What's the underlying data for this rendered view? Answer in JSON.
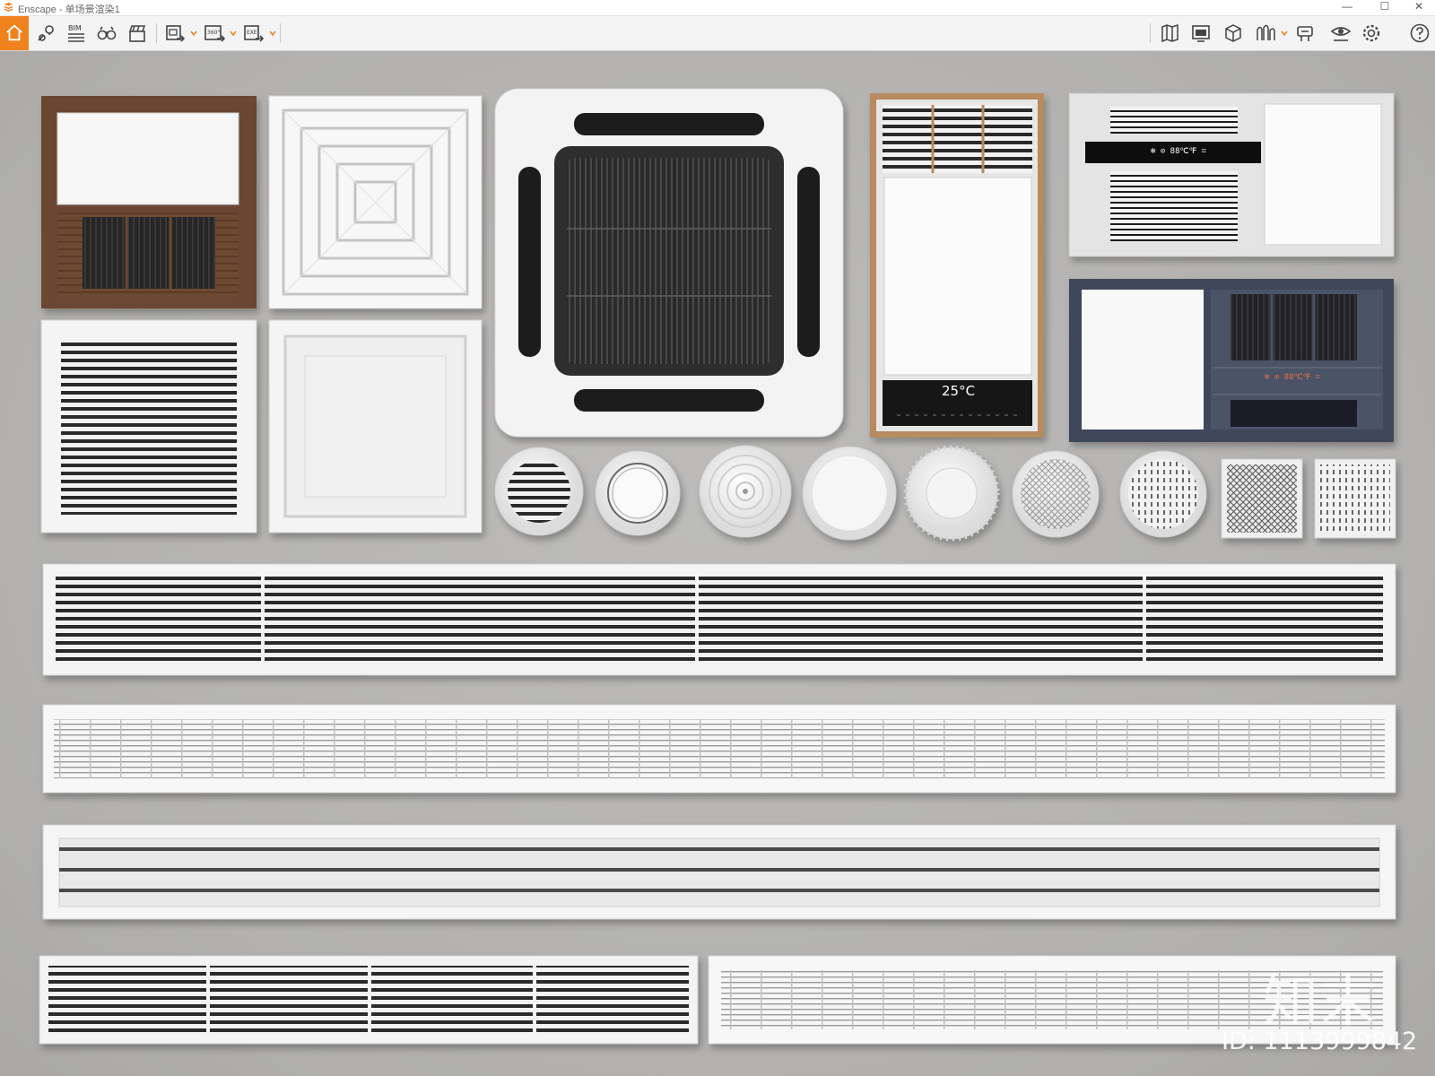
{
  "window": {
    "app_title": "Enscape - 单场景渲染1",
    "minimize": "—",
    "maximize": "☐",
    "close": "✕"
  },
  "toolbar": {
    "bim_label": "BIM",
    "btn_360": "360°",
    "btn_exe": "EXE",
    "left_icons": [
      "home-icon",
      "location-pin-icon",
      "bim-icon",
      "binoculars-icon",
      "clapperboard-icon",
      "batch-render-icon",
      "panorama-360-icon",
      "export-exe-icon"
    ],
    "right_icons": [
      "map-icon",
      "screen-display-icon",
      "cube-icon",
      "material-icon",
      "object-library-icon",
      "visual-settings-icon",
      "settings-gear-icon",
      "help-icon"
    ],
    "accent_color": "#f0821e"
  },
  "scene": {
    "panel_display_temperature": "25°C",
    "panel_display_a": "❄ ⊙  88℃℉ ⌗",
    "panel_display_b": "❄ ⊙  88℃℉ ⌗",
    "watermark_logo": "知末",
    "watermark_id": "ID: 1113999842",
    "background_color": "#b5b4b2"
  }
}
